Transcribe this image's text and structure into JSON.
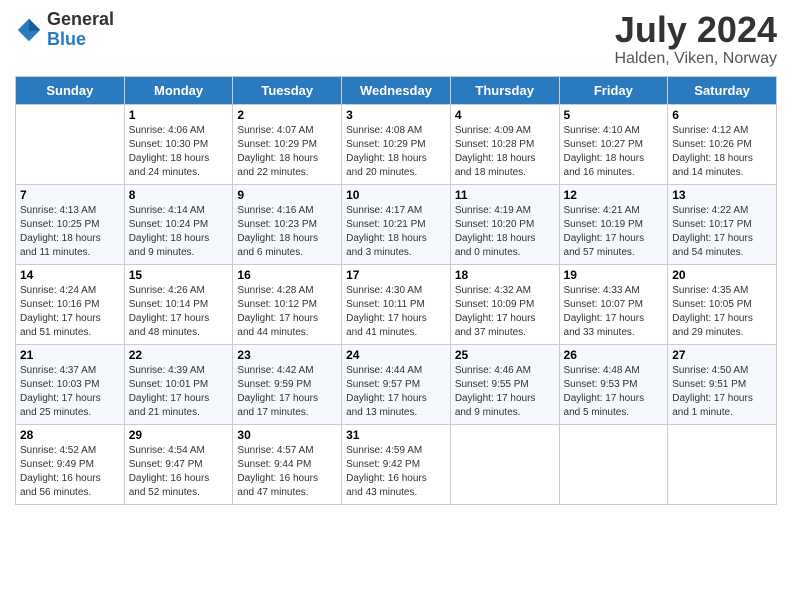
{
  "header": {
    "logo_general": "General",
    "logo_blue": "Blue",
    "month_year": "July 2024",
    "location": "Halden, Viken, Norway"
  },
  "weekdays": [
    "Sunday",
    "Monday",
    "Tuesday",
    "Wednesday",
    "Thursday",
    "Friday",
    "Saturday"
  ],
  "weeks": [
    [
      {
        "day": "",
        "sunrise": "",
        "sunset": "",
        "daylight": ""
      },
      {
        "day": "1",
        "sunrise": "Sunrise: 4:06 AM",
        "sunset": "Sunset: 10:30 PM",
        "daylight": "Daylight: 18 hours and 24 minutes."
      },
      {
        "day": "2",
        "sunrise": "Sunrise: 4:07 AM",
        "sunset": "Sunset: 10:29 PM",
        "daylight": "Daylight: 18 hours and 22 minutes."
      },
      {
        "day": "3",
        "sunrise": "Sunrise: 4:08 AM",
        "sunset": "Sunset: 10:29 PM",
        "daylight": "Daylight: 18 hours and 20 minutes."
      },
      {
        "day": "4",
        "sunrise": "Sunrise: 4:09 AM",
        "sunset": "Sunset: 10:28 PM",
        "daylight": "Daylight: 18 hours and 18 minutes."
      },
      {
        "day": "5",
        "sunrise": "Sunrise: 4:10 AM",
        "sunset": "Sunset: 10:27 PM",
        "daylight": "Daylight: 18 hours and 16 minutes."
      },
      {
        "day": "6",
        "sunrise": "Sunrise: 4:12 AM",
        "sunset": "Sunset: 10:26 PM",
        "daylight": "Daylight: 18 hours and 14 minutes."
      }
    ],
    [
      {
        "day": "7",
        "sunrise": "Sunrise: 4:13 AM",
        "sunset": "Sunset: 10:25 PM",
        "daylight": "Daylight: 18 hours and 11 minutes."
      },
      {
        "day": "8",
        "sunrise": "Sunrise: 4:14 AM",
        "sunset": "Sunset: 10:24 PM",
        "daylight": "Daylight: 18 hours and 9 minutes."
      },
      {
        "day": "9",
        "sunrise": "Sunrise: 4:16 AM",
        "sunset": "Sunset: 10:23 PM",
        "daylight": "Daylight: 18 hours and 6 minutes."
      },
      {
        "day": "10",
        "sunrise": "Sunrise: 4:17 AM",
        "sunset": "Sunset: 10:21 PM",
        "daylight": "Daylight: 18 hours and 3 minutes."
      },
      {
        "day": "11",
        "sunrise": "Sunrise: 4:19 AM",
        "sunset": "Sunset: 10:20 PM",
        "daylight": "Daylight: 18 hours and 0 minutes."
      },
      {
        "day": "12",
        "sunrise": "Sunrise: 4:21 AM",
        "sunset": "Sunset: 10:19 PM",
        "daylight": "Daylight: 17 hours and 57 minutes."
      },
      {
        "day": "13",
        "sunrise": "Sunrise: 4:22 AM",
        "sunset": "Sunset: 10:17 PM",
        "daylight": "Daylight: 17 hours and 54 minutes."
      }
    ],
    [
      {
        "day": "14",
        "sunrise": "Sunrise: 4:24 AM",
        "sunset": "Sunset: 10:16 PM",
        "daylight": "Daylight: 17 hours and 51 minutes."
      },
      {
        "day": "15",
        "sunrise": "Sunrise: 4:26 AM",
        "sunset": "Sunset: 10:14 PM",
        "daylight": "Daylight: 17 hours and 48 minutes."
      },
      {
        "day": "16",
        "sunrise": "Sunrise: 4:28 AM",
        "sunset": "Sunset: 10:12 PM",
        "daylight": "Daylight: 17 hours and 44 minutes."
      },
      {
        "day": "17",
        "sunrise": "Sunrise: 4:30 AM",
        "sunset": "Sunset: 10:11 PM",
        "daylight": "Daylight: 17 hours and 41 minutes."
      },
      {
        "day": "18",
        "sunrise": "Sunrise: 4:32 AM",
        "sunset": "Sunset: 10:09 PM",
        "daylight": "Daylight: 17 hours and 37 minutes."
      },
      {
        "day": "19",
        "sunrise": "Sunrise: 4:33 AM",
        "sunset": "Sunset: 10:07 PM",
        "daylight": "Daylight: 17 hours and 33 minutes."
      },
      {
        "day": "20",
        "sunrise": "Sunrise: 4:35 AM",
        "sunset": "Sunset: 10:05 PM",
        "daylight": "Daylight: 17 hours and 29 minutes."
      }
    ],
    [
      {
        "day": "21",
        "sunrise": "Sunrise: 4:37 AM",
        "sunset": "Sunset: 10:03 PM",
        "daylight": "Daylight: 17 hours and 25 minutes."
      },
      {
        "day": "22",
        "sunrise": "Sunrise: 4:39 AM",
        "sunset": "Sunset: 10:01 PM",
        "daylight": "Daylight: 17 hours and 21 minutes."
      },
      {
        "day": "23",
        "sunrise": "Sunrise: 4:42 AM",
        "sunset": "Sunset: 9:59 PM",
        "daylight": "Daylight: 17 hours and 17 minutes."
      },
      {
        "day": "24",
        "sunrise": "Sunrise: 4:44 AM",
        "sunset": "Sunset: 9:57 PM",
        "daylight": "Daylight: 17 hours and 13 minutes."
      },
      {
        "day": "25",
        "sunrise": "Sunrise: 4:46 AM",
        "sunset": "Sunset: 9:55 PM",
        "daylight": "Daylight: 17 hours and 9 minutes."
      },
      {
        "day": "26",
        "sunrise": "Sunrise: 4:48 AM",
        "sunset": "Sunset: 9:53 PM",
        "daylight": "Daylight: 17 hours and 5 minutes."
      },
      {
        "day": "27",
        "sunrise": "Sunrise: 4:50 AM",
        "sunset": "Sunset: 9:51 PM",
        "daylight": "Daylight: 17 hours and 1 minute."
      }
    ],
    [
      {
        "day": "28",
        "sunrise": "Sunrise: 4:52 AM",
        "sunset": "Sunset: 9:49 PM",
        "daylight": "Daylight: 16 hours and 56 minutes."
      },
      {
        "day": "29",
        "sunrise": "Sunrise: 4:54 AM",
        "sunset": "Sunset: 9:47 PM",
        "daylight": "Daylight: 16 hours and 52 minutes."
      },
      {
        "day": "30",
        "sunrise": "Sunrise: 4:57 AM",
        "sunset": "Sunset: 9:44 PM",
        "daylight": "Daylight: 16 hours and 47 minutes."
      },
      {
        "day": "31",
        "sunrise": "Sunrise: 4:59 AM",
        "sunset": "Sunset: 9:42 PM",
        "daylight": "Daylight: 16 hours and 43 minutes."
      },
      {
        "day": "",
        "sunrise": "",
        "sunset": "",
        "daylight": ""
      },
      {
        "day": "",
        "sunrise": "",
        "sunset": "",
        "daylight": ""
      },
      {
        "day": "",
        "sunrise": "",
        "sunset": "",
        "daylight": ""
      }
    ]
  ]
}
